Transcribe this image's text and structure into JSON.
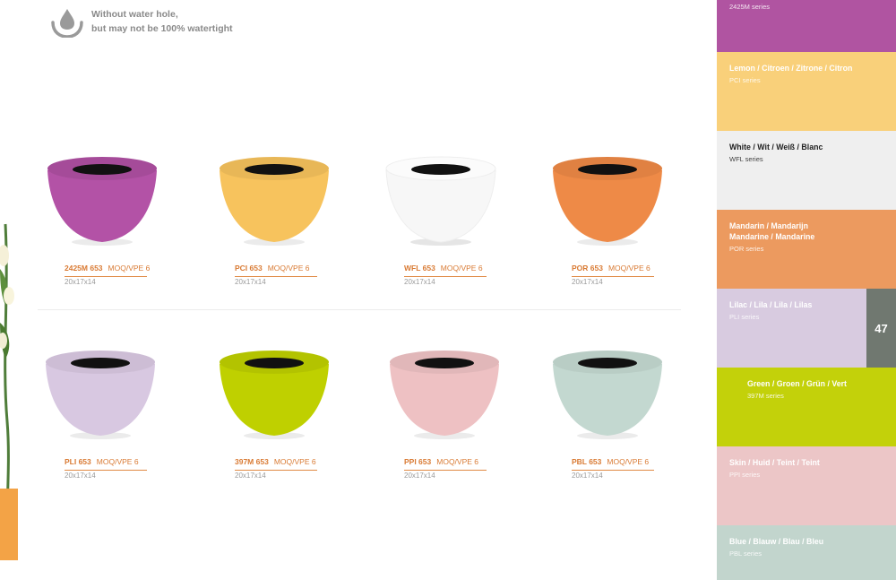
{
  "note": {
    "line1": "Without water hole,",
    "line2": "but may not be 100% watertight"
  },
  "moq_label": "MOQ/VPE 6",
  "dimensions": "20x17x14",
  "page_number": "47",
  "products": [
    {
      "code": "2425M 653",
      "color": "#b352a6"
    },
    {
      "code": "PCI 653",
      "color": "#f7c35d"
    },
    {
      "code": "WFL 653",
      "color": "#f6f6f6"
    },
    {
      "code": "POR 653",
      "color": "#ee8a47"
    },
    {
      "code": "PLI 653",
      "color": "#d8c8e1"
    },
    {
      "code": "397M 653",
      "color": "#bfd000"
    },
    {
      "code": "PPI 653",
      "color": "#eec1c3"
    },
    {
      "code": "PBL 653",
      "color": "#c3d8d0"
    }
  ],
  "swatches": [
    {
      "name": "",
      "name2": "",
      "series": "2425M series",
      "bg": "#b054a1",
      "fg": "#ffffff"
    },
    {
      "name": "Lemon / Citroen / Zitrone / Citron",
      "name2": "",
      "series": "PCI series",
      "bg": "#f9d07a",
      "fg": "#ffffff"
    },
    {
      "name": "White / Wit / Weiß / Blanc",
      "name2": "",
      "series": "WFL series",
      "bg": "#efefef",
      "fg": "#222222"
    },
    {
      "name": "Mandarin / Mandarijn",
      "name2": "Mandarine / Mandarine",
      "series": "POR series",
      "bg": "#ec9a5f",
      "fg": "#ffffff"
    },
    {
      "name": "Lilac / Lila / Lila / Lilas",
      "name2": "",
      "series": "PLI series",
      "bg": "#d8cbe0",
      "fg": "#ffffff"
    },
    {
      "name": "Green / Groen / Grün / Vert",
      "name2": "",
      "series": "397M series",
      "bg": "#c3d10a",
      "fg": "#ffffff"
    },
    {
      "name": "Skin / Huid / Teint / Teint",
      "name2": "",
      "series": "PPI series",
      "bg": "#ecc6c7",
      "fg": "#ffffff"
    },
    {
      "name": "Blue / Blauw / Blau / Bleu",
      "name2": "",
      "series": "PBL series",
      "bg": "#c2d5cd",
      "fg": "#ffffff"
    }
  ]
}
